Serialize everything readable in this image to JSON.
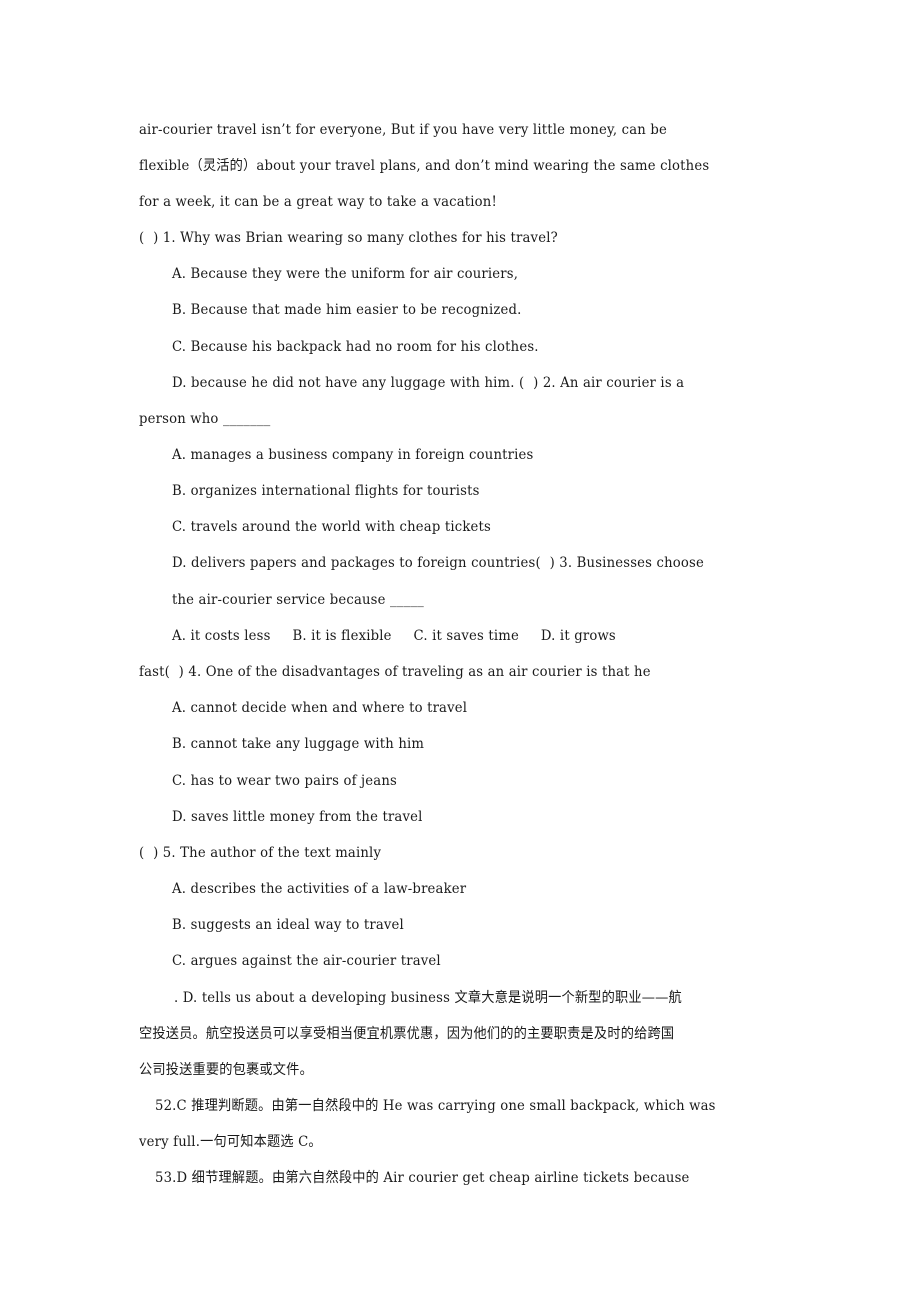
{
  "passage_end": [
    "air-courier travel isn’t for everyone, But if you have very little money, can be",
    "flexible（灵活的）about your travel plans, and don’t mind wearing the same clothes",
    "for a week, it can be a great way to take a vacation!"
  ],
  "questions": [
    {
      "stem": "(  ) 1. Why was Brian wearing so many clothes for his travel?",
      "options": [
        "A. Because they were the uniform for air couriers,",
        "B. Because that made him easier to be recognized.",
        "C. Because his backpack had no room for his clothes.",
        "D. because he did not have any luggage with him. (  ) 2. An air courier is a"
      ]
    },
    {
      "stem_cont": "person who _______",
      "options": [
        "A. manages a business company in foreign countries",
        "B. organizes international flights for tourists",
        "C. travels around the world with cheap tickets",
        "D. delivers papers and packages to foreign countries(  ) 3. Businesses choose"
      ]
    },
    {
      "stem_cont": "the air-courier service because _____",
      "options": [
        "A. it costs less     B. it is flexible     C. it saves time     D. it grows"
      ]
    },
    {
      "stem_cont": "fast(  ) 4. One of the disadvantages of traveling as an air courier is that he",
      "options": [
        "A. cannot decide when and where to travel",
        "B. cannot take any luggage with him",
        "C. has to wear two pairs of jeans",
        "D. saves little money from the travel"
      ]
    },
    {
      "stem": "(  ) 5. The author of the text mainly",
      "options": [
        "A. describes the activities of a law-breaker",
        "B. suggests an ideal way to travel",
        "C. argues against the air-courier travel",
        ". D. tells us about a developing business 文章大意是说明一个新型的职业——航"
      ]
    }
  ],
  "analysis": [
    "空投送员。航空投送员可以享受相当便宜机票优惠，因为他们的的主要职责是及时的给跨国",
    "公司投送重要的包裹或文件。",
    "52.C 推理判断题。由第一自然段中的 He was carrying one small backpack, which was",
    "very full.一句可知本题选 C。",
    "53.D 细节理解题。由第六自然段中的 Air courier get cheap airline tickets because"
  ]
}
